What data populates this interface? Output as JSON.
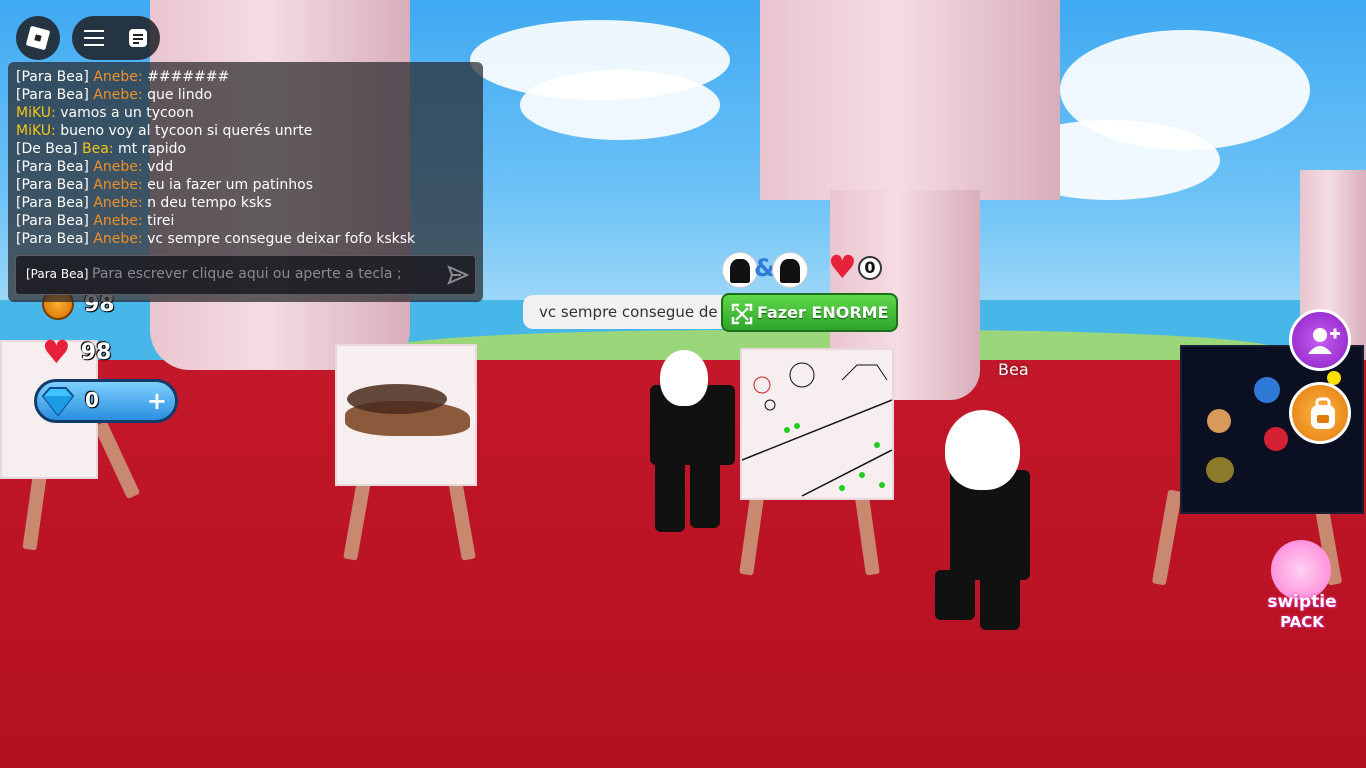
{
  "hud": {
    "roblox_menu": "roblox-logo-icon",
    "hamburger": "hamburger-icon",
    "chat_toggle": "chat-icon"
  },
  "chat": {
    "messages": [
      {
        "prefix": "[Para Bea] ",
        "name": "Anebe:",
        "text": " #######",
        "color": "orange"
      },
      {
        "prefix": "[Para Bea] ",
        "name": "Anebe:",
        "text": " que lindo",
        "color": "orange"
      },
      {
        "prefix": "",
        "name": "MiKU:",
        "text": " vamos a un tycoon",
        "color": "yellow"
      },
      {
        "prefix": "",
        "name": "MiKU:",
        "text": " bueno voy al tycoon si querés unrte",
        "color": "yellow"
      },
      {
        "prefix": "[De Bea] ",
        "name": "Bea:",
        "text": " mt rapido",
        "color": "yellow"
      },
      {
        "prefix": "[Para Bea] ",
        "name": "Anebe:",
        "text": " vdd",
        "color": "orange"
      },
      {
        "prefix": "[Para Bea] ",
        "name": "Anebe:",
        "text": " eu ia fazer um patinhos",
        "color": "orange"
      },
      {
        "prefix": "[Para Bea] ",
        "name": "Anebe:",
        "text": " n deu tempo ksks",
        "color": "orange"
      },
      {
        "prefix": "[Para Bea] ",
        "name": "Anebe:",
        "text": " tirei",
        "color": "orange"
      },
      {
        "prefix": "[Para Bea] ",
        "name": "Anebe:",
        "text": " vc sempre consegue deixar fofo ksksk",
        "color": "orange"
      }
    ],
    "input_tag": "[Para Bea]",
    "input_placeholder": "Para escrever clique aqui ou aperte a tecla ;"
  },
  "stats": {
    "coins": "98",
    "hearts": "98",
    "gems": "0",
    "gem_plus": "+"
  },
  "world": {
    "speech_bubble": "vc sempre consegue de",
    "grow_button": "Fazer ENORME",
    "pair_symbol": "&",
    "like_count": "0",
    "player_tag": "Bea",
    "pack_label_1": "swiptie",
    "pack_label_2": "PACK"
  },
  "colors": {
    "chat_orange": "#f0902a",
    "chat_yellow": "#f5c518",
    "grow_green": "#3cbf36",
    "floor_red": "#b71624"
  }
}
